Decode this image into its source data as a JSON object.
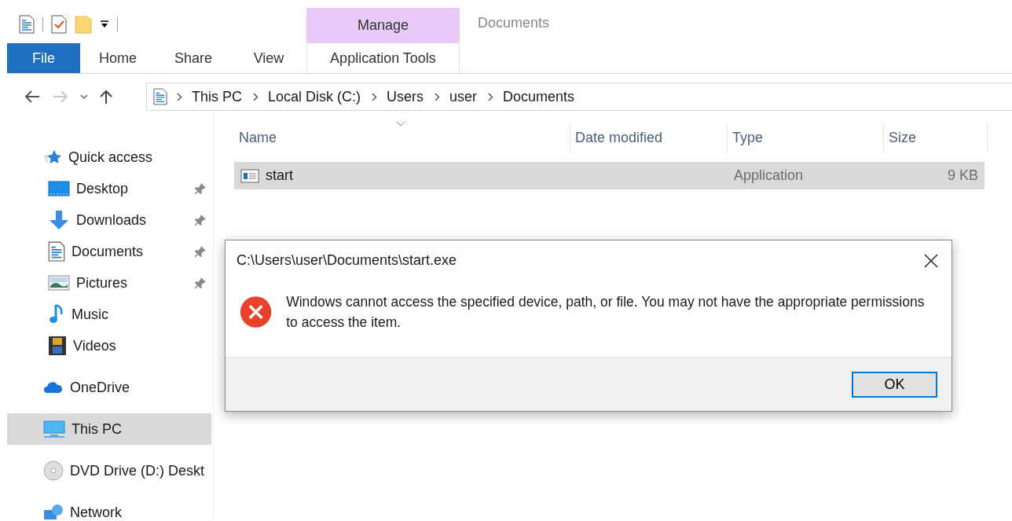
{
  "ribbon": {
    "context_group": "Manage",
    "window_title": "Documents",
    "tabs": [
      {
        "label": "File",
        "kind": "file"
      },
      {
        "label": "Home",
        "kind": "normal"
      },
      {
        "label": "Share",
        "kind": "normal"
      },
      {
        "label": "View",
        "kind": "normal"
      },
      {
        "label": "Application Tools",
        "kind": "context"
      }
    ]
  },
  "navigation": {
    "forward_disabled": true,
    "breadcrumbs": [
      "This PC",
      "Local Disk (C:)",
      "Users",
      "user",
      "Documents"
    ]
  },
  "sidebar": {
    "items": [
      {
        "label": "Quick access",
        "selected": false,
        "children": [
          {
            "label": "Desktop",
            "pinned": true,
            "selected": false
          },
          {
            "label": "Downloads",
            "pinned": true,
            "selected": false
          },
          {
            "label": "Documents",
            "pinned": true,
            "selected": false
          },
          {
            "label": "Pictures",
            "pinned": true,
            "selected": false
          },
          {
            "label": "Music",
            "pinned": false,
            "selected": false
          },
          {
            "label": "Videos",
            "pinned": false,
            "selected": false
          }
        ]
      },
      {
        "label": "OneDrive",
        "selected": false
      },
      {
        "label": "This PC",
        "selected": true
      },
      {
        "label": "DVD Drive (D:) Deskt",
        "selected": false
      },
      {
        "label": "Network",
        "selected": false
      }
    ]
  },
  "table": {
    "columns": [
      "Name",
      "Date modified",
      "Type",
      "Size"
    ],
    "rows": [
      {
        "name": "start",
        "date_modified": "",
        "type": "Application",
        "size": "9 KB",
        "selected": true
      }
    ]
  },
  "dialog": {
    "title": "C:\\Users\\user\\Documents\\start.exe",
    "message": "Windows cannot access the specified device, path, or file. You may not have the appropriate permissions to access the item.",
    "buttons": [
      "OK"
    ]
  }
}
